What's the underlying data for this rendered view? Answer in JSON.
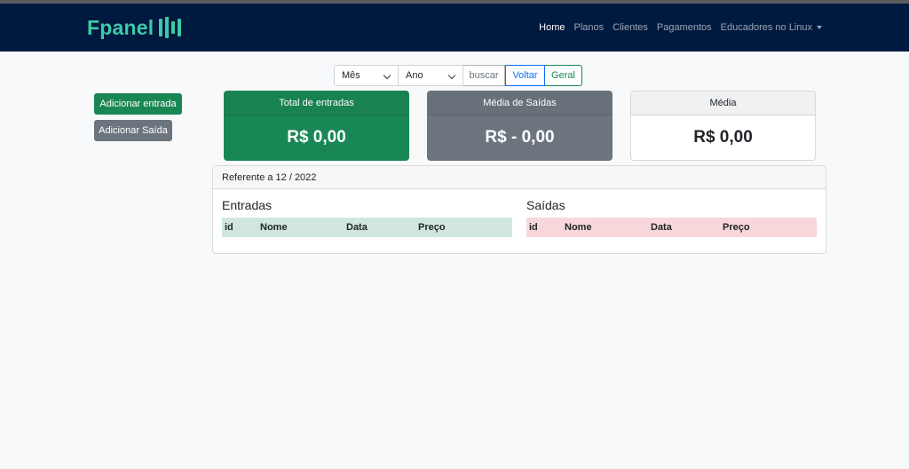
{
  "navbar": {
    "brand": "Fpanel",
    "links": [
      "Home",
      "Planos",
      "Clientes",
      "Pagamentos",
      "Educadores no Linux"
    ]
  },
  "filters": {
    "month": "Mês",
    "year": "Ano",
    "search": "buscar",
    "back": "Voltar",
    "all": "Geral"
  },
  "actions": {
    "add_in": "Adicionar entrada",
    "add_out": "Adicionar Saída"
  },
  "cards": {
    "total_in": {
      "title": "Total de entradas",
      "value": "R$ 0,00"
    },
    "avg_out": {
      "title": "Média de Saídas",
      "value": "R$ - 0,00"
    },
    "avg": {
      "title": "Média",
      "value": "R$ 0,00"
    }
  },
  "panel": {
    "header": "Referente a 12 / 2022",
    "entradas": {
      "title": "Entradas",
      "columns": [
        "id",
        "Nome",
        "Data",
        "Preço"
      ]
    },
    "saidas": {
      "title": "Saídas",
      "columns": [
        "id",
        "Nome",
        "Data",
        "Preço"
      ]
    }
  },
  "colors": {
    "navbar": "#001a3f",
    "brand": "#3ec9a7",
    "success": "#198754",
    "secondary": "#6c757d",
    "primary": "#0d6efd"
  }
}
